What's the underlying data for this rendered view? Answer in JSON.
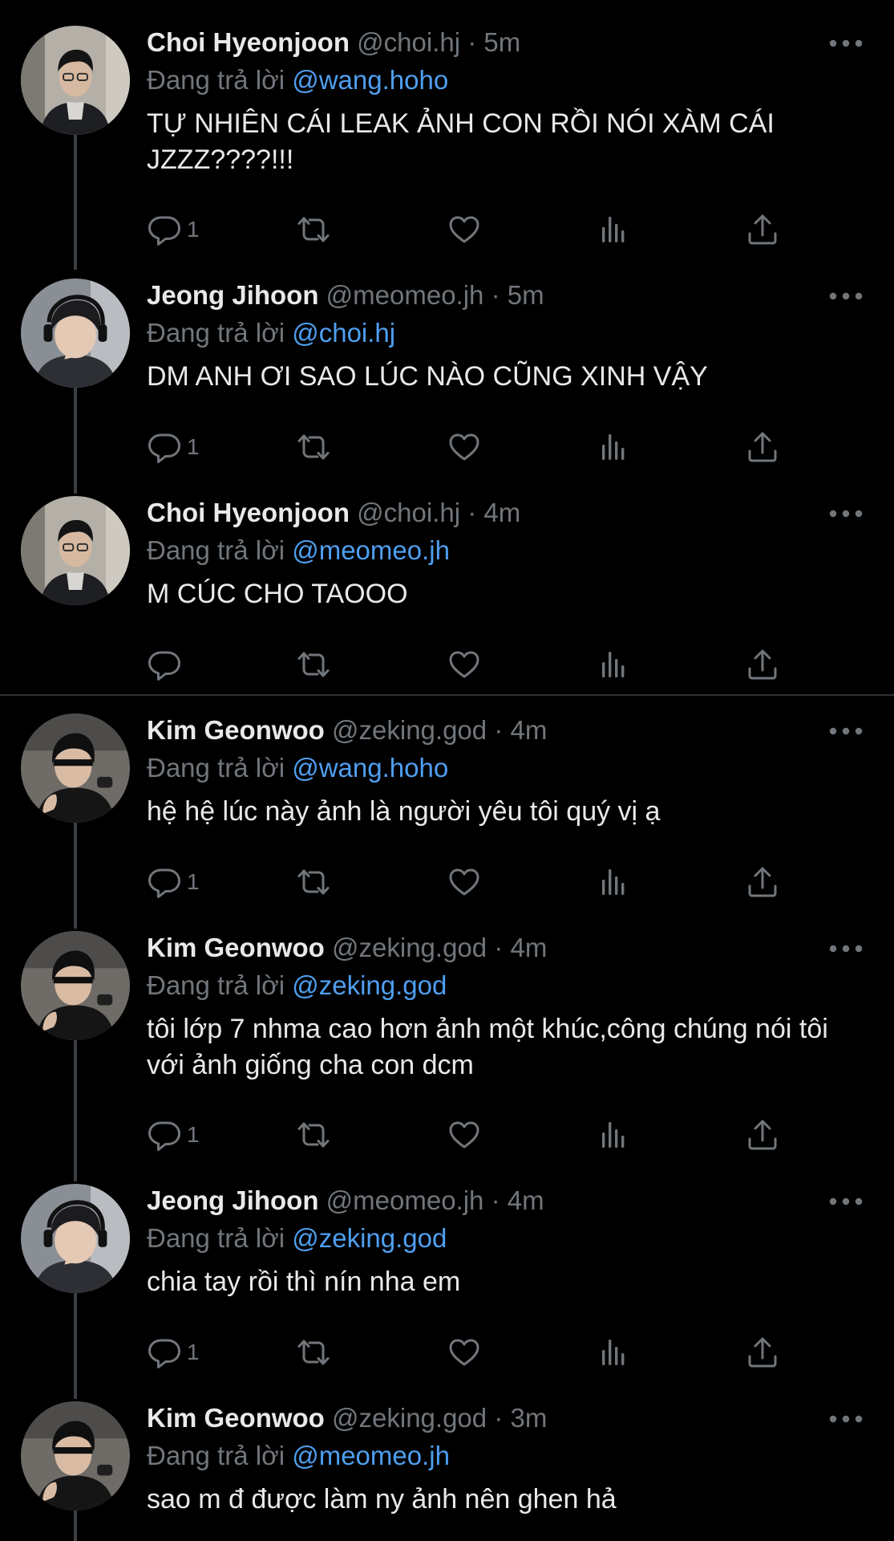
{
  "reply_label": "Đang trả lời",
  "colors": {
    "background": "#000000",
    "text": "#e7e9ea",
    "muted": "#71767b",
    "mention": "#4f9ff0",
    "rail": "#3b3f44"
  },
  "icons": {
    "more": "more-horizontal-icon",
    "reply": "reply-bubble-icon",
    "retweet": "retweet-icon",
    "like": "heart-icon",
    "views": "views-bar-chart-icon",
    "share": "share-upload-icon"
  },
  "tweets": [
    {
      "name": "Choi Hyeonjoon",
      "handle": "@choi.hj",
      "dot": "·",
      "time": "5m",
      "reply_to": "@wang.hoho",
      "text": "TỰ NHIÊN CÁI LEAK ẢNH CON RỒI NÓI XÀM CÁI JZZZ????!!!",
      "reply_count": "1"
    },
    {
      "name": "Jeong Jihoon",
      "handle": "@meomeo.jh",
      "dot": "·",
      "time": "5m",
      "reply_to": "@choi.hj",
      "text": "DM ANH ƠI SAO LÚC NÀO CŨNG XINH VẬY",
      "reply_count": "1"
    },
    {
      "name": "Choi Hyeonjoon",
      "handle": "@choi.hj",
      "dot": "·",
      "time": "4m",
      "reply_to": "@meomeo.jh",
      "text": "M CÚC CHO TAOOO",
      "reply_count": ""
    },
    {
      "name": "Kim Geonwoo",
      "handle": "@zeking.god",
      "dot": "·",
      "time": "4m",
      "reply_to": "@wang.hoho",
      "text": "hệ hệ lúc này ảnh là người yêu tôi quý vị ạ",
      "reply_count": "1"
    },
    {
      "name": "Kim Geonwoo",
      "handle": "@zeking.god",
      "dot": "·",
      "time": "4m",
      "reply_to": "@zeking.god",
      "text": "tôi lớp 7 nhma cao hơn ảnh một khúc,công chúng nói tôi với ảnh giống cha con dcm",
      "reply_count": "1"
    },
    {
      "name": "Jeong Jihoon",
      "handle": "@meomeo.jh",
      "dot": "·",
      "time": "4m",
      "reply_to": "@zeking.god",
      "text": "chia tay rồi thì nín nha em",
      "reply_count": "1"
    },
    {
      "name": "Kim Geonwoo",
      "handle": "@zeking.god",
      "dot": "·",
      "time": "3m",
      "reply_to": "@meomeo.jh",
      "text": "sao m đ được làm ny ảnh nên ghen hả",
      "reply_count": ""
    }
  ]
}
